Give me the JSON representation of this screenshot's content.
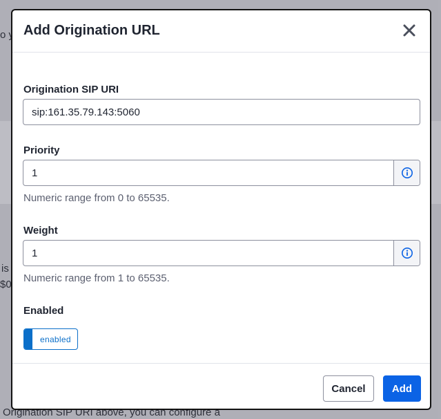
{
  "background": {
    "text_top": "o y",
    "text_mid1": "is",
    "text_mid2": "$0",
    "text_bottom": "Origination SIP URI above, you can configure a"
  },
  "modal": {
    "title": "Add Origination URL",
    "close_icon": "close-icon",
    "fields": {
      "sip_uri": {
        "label": "Origination SIP URI",
        "value": "sip:161.35.79.143:5060"
      },
      "priority": {
        "label": "Priority",
        "value": "1",
        "help": "Numeric range from 0 to 65535.",
        "addon_icon": "info-icon"
      },
      "weight": {
        "label": "Weight",
        "value": "1",
        "help": "Numeric range from 1 to 65535.",
        "addon_icon": "info-icon"
      },
      "enabled": {
        "label": "Enabled",
        "toggle_text": "enabled",
        "state": true
      }
    },
    "footer": {
      "cancel_label": "Cancel",
      "add_label": "Add"
    }
  },
  "colors": {
    "primary": "#0b63e5",
    "toggle_accent": "#0b6fc9",
    "border": "#8c8f9d",
    "text": "#1f2430",
    "muted": "#5c6070"
  }
}
